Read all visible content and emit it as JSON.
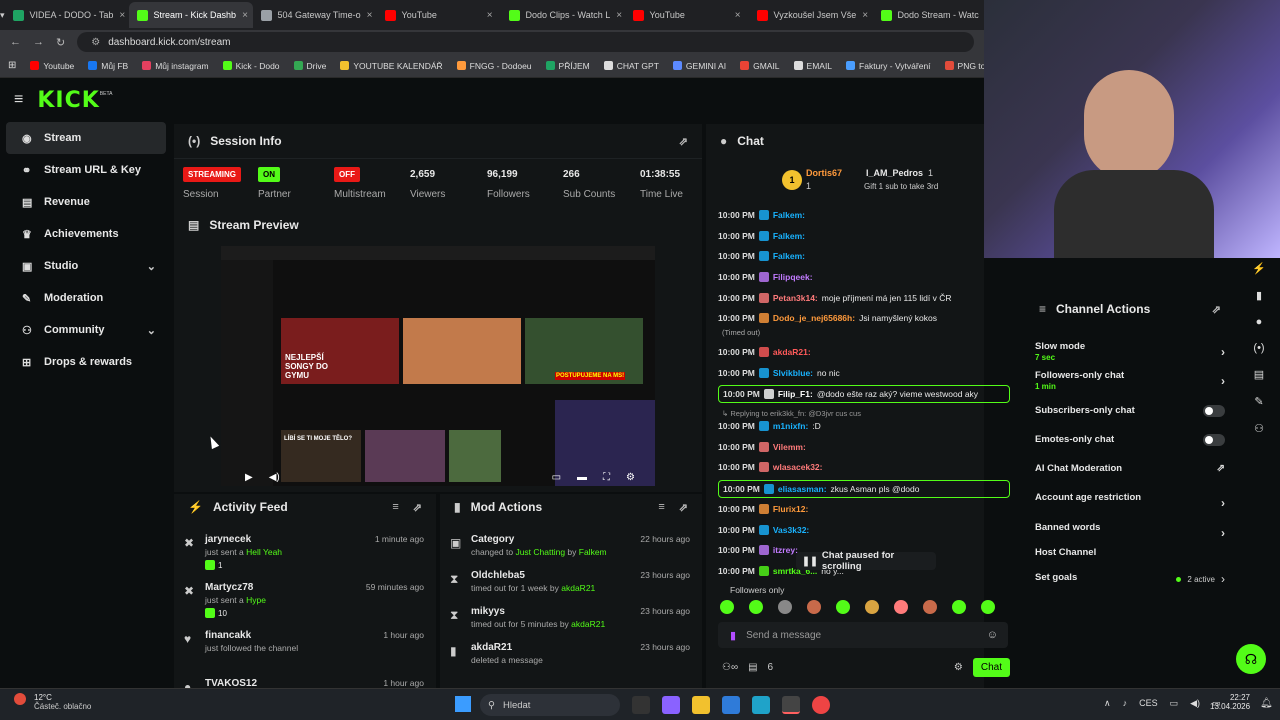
{
  "browser": {
    "tabs": [
      {
        "label": "VIDEA - DODO - Tab",
        "color": "#1fa463"
      },
      {
        "label": "Stream - Kick Dashb",
        "color": "#53fc18"
      },
      {
        "label": "504 Gateway Time-o",
        "color": "#9aa0a6"
      },
      {
        "label": "YouTube",
        "color": "#ff0000"
      },
      {
        "label": "Dodo Clips - Watch L",
        "color": "#53fc18"
      },
      {
        "label": "YouTube",
        "color": "#ff0000"
      },
      {
        "label": "Vyzkoušel Jsem Vše",
        "color": "#ff0000"
      },
      {
        "label": "Dodo Stream - Watc",
        "color": "#53fc18"
      }
    ],
    "url": "dashboard.kick.com/stream",
    "bookmarks": [
      "Youtube",
      "Můj FB",
      "Můj instagram",
      "Kick - Dodo",
      "Drive",
      "YOUTUBE KALENDÁŘ",
      "FNGG - Dodoeu",
      "PŘÍJEM",
      "CHAT GPT",
      "GEMINI AI",
      "GMAIL",
      "EMAIL",
      "Faktury - Vytváření",
      "PNG to PDF"
    ]
  },
  "logo": "KICK",
  "logo_sup": "BETA",
  "sidebar": [
    {
      "label": "Stream",
      "icon": "broadcast-icon",
      "glyph": "◉"
    },
    {
      "label": "Stream URL & Key",
      "icon": "link-icon",
      "glyph": "⚭"
    },
    {
      "label": "Revenue",
      "icon": "revenue-icon",
      "glyph": "▤"
    },
    {
      "label": "Achievements",
      "icon": "trophy-icon",
      "glyph": "♛"
    },
    {
      "label": "Studio",
      "icon": "studio-icon",
      "glyph": "▣"
    },
    {
      "label": "Moderation",
      "icon": "wrench-icon",
      "glyph": "✎"
    },
    {
      "label": "Community",
      "icon": "community-icon",
      "glyph": "⚇"
    },
    {
      "label": "Drops & rewards",
      "icon": "gift-icon",
      "glyph": "⊞"
    }
  ],
  "session": {
    "title": "Session Info",
    "streaming_badge": "STREAMING",
    "session_label": "Session",
    "partner_badge": "ON",
    "partner_label": "Partner",
    "multistream_badge": "OFF",
    "multistream_label": "Multistream",
    "viewers": "2,659",
    "viewers_label": "Viewers",
    "followers": "96,199",
    "followers_label": "Followers",
    "subs": "266",
    "subs_label": "Sub Counts",
    "time": "01:38:55",
    "time_label": "Time Live"
  },
  "preview": {
    "title": "Stream Preview",
    "thumb1": "NEJLEPŠÍ SONGY DO GYMU",
    "thumb2": "LÍBÍ SE TI MOJE TĚLO?",
    "thumb3": "POSTUPUJEME NA MS!"
  },
  "activity": {
    "title": "Activity Feed",
    "items": [
      {
        "name": "jarynecek",
        "pre": "just sent a ",
        "hl": "Hell Yeah",
        "time": "1 minute ago",
        "count": "1"
      },
      {
        "name": "Martycz78",
        "pre": "just sent a ",
        "hl": "Hype",
        "time": "59 minutes ago",
        "count": "10"
      },
      {
        "name": "financakk",
        "pre": "just followed the channel",
        "hl": "",
        "time": "1 hour ago",
        "count": ""
      },
      {
        "name": "TVAKOS12",
        "pre": "",
        "hl": "",
        "time": "1 hour ago",
        "count": ""
      }
    ]
  },
  "mod": {
    "title": "Mod Actions",
    "items": [
      {
        "name": "Category",
        "pre": "changed to ",
        "hl": "Just Chatting",
        "mid": " by ",
        "by": "Falkem",
        "time": "22 hours ago"
      },
      {
        "name": "Oldchleba5",
        "pre": "timed out for 1 week by ",
        "hl": "akdaR21",
        "mid": "",
        "by": "",
        "time": "23 hours ago"
      },
      {
        "name": "mikyys",
        "pre": "timed out for 5 minutes by ",
        "hl": "akdaR21",
        "mid": "",
        "by": "",
        "time": "23 hours ago"
      },
      {
        "name": "akdaR21",
        "pre": "deleted a message",
        "hl": "",
        "mid": "",
        "by": "",
        "time": "23 hours ago"
      }
    ]
  },
  "chat": {
    "title": "Chat",
    "top1_name": "Dortis67",
    "top1_count": "1",
    "top2_name": "I_AM_Pedros",
    "top2_count": "1",
    "gift_text": "Gift 1 sub to take 3rd",
    "messages": [
      {
        "time": "10:00 PM",
        "user": "Falkem:",
        "color": "#19b3ff",
        "text": "",
        "hl": false
      },
      {
        "time": "10:00 PM",
        "user": "Falkem:",
        "color": "#19b3ff",
        "text": "",
        "hl": false
      },
      {
        "time": "10:00 PM",
        "user": "Falkem:",
        "color": "#19b3ff",
        "text": "",
        "hl": false
      },
      {
        "time": "10:00 PM",
        "user": "Filipqeek:",
        "color": "#c27bff",
        "text": "",
        "hl": false
      },
      {
        "time": "10:00 PM",
        "user": "Petan3k14:",
        "color": "#ff7b7b",
        "text": "moje příjmení má jen 115 lidí v ČR",
        "hl": false
      },
      {
        "time": "10:00 PM",
        "user": "Dodo_je_nej65686h:",
        "color": "#ff9a3c",
        "text": "Jsi namyšlený kokos",
        "hl": false
      },
      {
        "time": "",
        "user": "",
        "color": "#aaaaaa",
        "text": "(Timed out)",
        "hl": false
      },
      {
        "time": "10:00 PM",
        "user": "akdaR21:",
        "color": "#ff5a5a",
        "text": "",
        "hl": false
      },
      {
        "time": "10:00 PM",
        "user": "Slvikblue:",
        "color": "#19b3ff",
        "text": "no nic",
        "hl": false
      },
      {
        "time": "10:00 PM",
        "user": "Filip_F1:",
        "color": "#ffffff",
        "text": "@dodo ešte raz aký? vieme westwood aky",
        "hl": true
      },
      {
        "time": "",
        "user": "",
        "color": "#999999",
        "text": "↳ Replying to erik3kk_fn: @D3jvr cus cus",
        "hl": false
      },
      {
        "time": "10:00 PM",
        "user": "m1nixfn:",
        "color": "#19b3ff",
        "text": ":D",
        "hl": false
      },
      {
        "time": "10:00 PM",
        "user": "Vilemm:",
        "color": "#ff7b7b",
        "text": "",
        "hl": false
      },
      {
        "time": "10:00 PM",
        "user": "wlasacek32:",
        "color": "#ff7b7b",
        "text": "",
        "hl": false
      },
      {
        "time": "10:00 PM",
        "user": "eliasasman:",
        "color": "#19b3ff",
        "text": "zkus Asman pls @dodo",
        "hl": true
      },
      {
        "time": "10:00 PM",
        "user": "Flurix12:",
        "color": "#ff9a3c",
        "text": "",
        "hl": false
      },
      {
        "time": "10:00 PM",
        "user": "Vas3k32:",
        "color": "#19b3ff",
        "text": "",
        "hl": false
      },
      {
        "time": "10:00 PM",
        "user": "itzrey:",
        "color": "#c27bff",
        "text": "",
        "hl": false
      },
      {
        "time": "10:00 PM",
        "user": "smrtka_6...",
        "color": "#53fc18",
        "text": "no y...",
        "hl": false
      }
    ],
    "paused": "Chat paused for scrolling",
    "followers_only": "Followers only",
    "input_placeholder": "Send a message",
    "viewers_count": "6",
    "send_label": "Chat"
  },
  "channel_actions": {
    "title": "Channel Actions",
    "items": [
      {
        "label": "Slow mode",
        "sub": "7 sec",
        "type": "chev"
      },
      {
        "label": "Followers-only chat",
        "sub": "1 min",
        "type": "chev"
      },
      {
        "label": "Subscribers-only chat",
        "sub": "",
        "type": "toggle"
      },
      {
        "label": "Emotes-only chat",
        "sub": "",
        "type": "toggle"
      },
      {
        "label": "AI Chat Moderation",
        "sub": "",
        "type": "ext"
      },
      {
        "label": "Account age restriction",
        "sub": "",
        "type": "chev"
      },
      {
        "label": "Banned words",
        "sub": "",
        "type": "chev"
      },
      {
        "label": "Host Channel",
        "sub": "",
        "type": "none"
      },
      {
        "label": "Set goals",
        "sub": "",
        "type": "goals"
      }
    ],
    "goals_active": "2 active"
  },
  "taskbar": {
    "weather_temp": "12°C",
    "weather_desc": "Částeč. oblačno",
    "search_placeholder": "Hledat",
    "lang": "CES",
    "time": "22:27",
    "date": "13.04.2026"
  },
  "colors": {
    "accent": "#53fc18",
    "bg": "#0b0e0f",
    "panel": "#121516",
    "streaming": "#e91916"
  }
}
